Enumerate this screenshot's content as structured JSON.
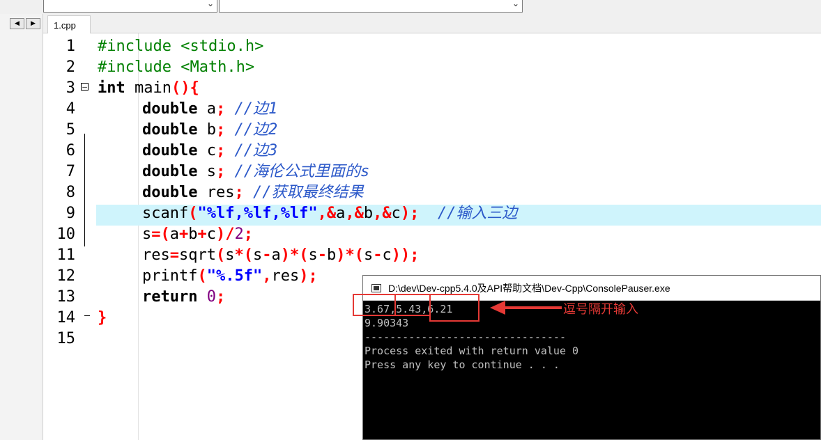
{
  "tab": {
    "label": "1.cpp"
  },
  "lines": [
    {
      "n": "1"
    },
    {
      "n": "2"
    },
    {
      "n": "3"
    },
    {
      "n": "4"
    },
    {
      "n": "5"
    },
    {
      "n": "6"
    },
    {
      "n": "7"
    },
    {
      "n": "8"
    },
    {
      "n": "9"
    },
    {
      "n": "10"
    },
    {
      "n": "11"
    },
    {
      "n": "12"
    },
    {
      "n": "13"
    },
    {
      "n": "14"
    },
    {
      "n": "15"
    }
  ],
  "code": {
    "l1": {
      "a": "#include <stdio.h>"
    },
    "l2": {
      "a": "#include <Math.h>"
    },
    "l3": {
      "kw": "int",
      "name": " main",
      "op": "(){"
    },
    "l4": {
      "kw": "double",
      "v": " a",
      "op": ";",
      "cm": " //边1"
    },
    "l5": {
      "kw": "double",
      "v": " b",
      "op": ";",
      "cm": " //边2"
    },
    "l6": {
      "kw": "double",
      "v": " c",
      "op": ";",
      "cm": " //边3"
    },
    "l7": {
      "kw": "double",
      "v": " s",
      "op": ";",
      "cm": " //海伦公式里面的s"
    },
    "l8": {
      "kw": "double",
      "v": " res",
      "op": ";",
      "cm": " //获取最终结果"
    },
    "l9": {
      "f": "scanf",
      "o1": "(",
      "s": "\"%lf,%lf,%lf\"",
      "o2": ",&",
      "a": "a",
      "o3": ",&",
      "b": "b",
      "o4": ",&",
      "c": "c",
      "o5": ");",
      "cm": "  //输入三边"
    },
    "l10": {
      "v1": "s",
      "o1": "=(",
      "v2": "a",
      "o2": "+",
      "v3": "b",
      "o3": "+",
      "v4": "c",
      "o4": ")/",
      "n": "2",
      "o5": ";"
    },
    "l11": {
      "v1": "res",
      "o1": "=",
      "f": "sqrt",
      "o2": "(",
      "v2": "s",
      "o3": "*(",
      "v3": "s",
      "o4": "-",
      "v4": "a",
      "o5": ")*(",
      "v5": "s",
      "o6": "-",
      "v6": "b",
      "o7": ")*(",
      "v7": "s",
      "o8": "-",
      "v8": "c",
      "o9": "));"
    },
    "l12": {
      "f": "printf",
      "o1": "(",
      "s": "\"%.5f\"",
      "o2": ",",
      "v": "res",
      "o3": ");"
    },
    "l13": {
      "kw": "return",
      "n": " 0",
      "op": ";"
    },
    "l14": {
      "op": "}"
    }
  },
  "console": {
    "title": "D:\\dev\\Dev-cpp5.4.0及API帮助文档\\Dev-Cpp\\ConsolePauser.exe",
    "lines": [
      "3.67,5.43,6.21",
      "9.90343",
      "--------------------------------",
      "Process exited with return value 0",
      "Press any key to continue . . ."
    ]
  },
  "annotation": {
    "text": "逗号隔开输入"
  },
  "colors": {
    "highlight": "#cff4fc",
    "annotation": "#e53935"
  }
}
